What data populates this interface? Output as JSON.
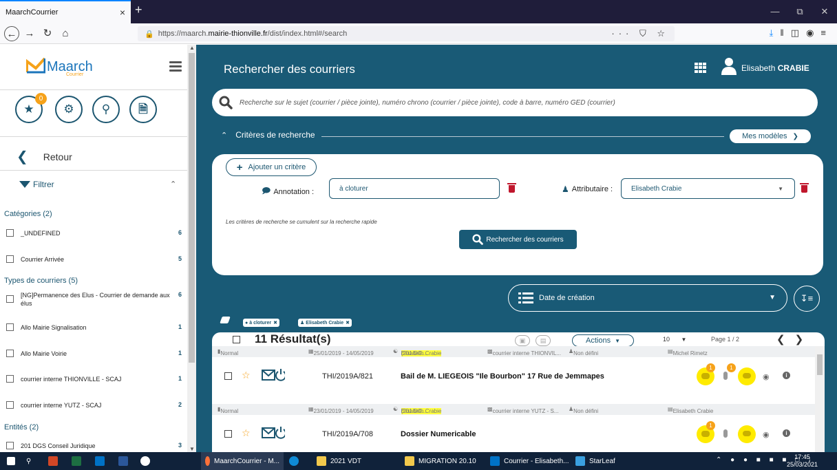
{
  "browser": {
    "tab_title": "MaarchCourrier",
    "tab_close": "×",
    "new_tab": "+",
    "url_prefix": "https://maarch.",
    "url_domain": "mairie-thionville.fr",
    "url_path": "/dist/index.html#/search",
    "url_icons": "··· ⛉ ☆"
  },
  "sidebar": {
    "logo_text": "Maarch",
    "logo_sub": "Courrier",
    "star_badge": "0",
    "retour_label": "Retour",
    "filter_label": "Filtrer",
    "categories_head": "Catégories (2)",
    "categories": [
      {
        "label": "_UNDEFINED",
        "count": "6"
      },
      {
        "label": "Courrier Arrivée",
        "count": "5"
      }
    ],
    "types_head": "Types de courriers (5)",
    "types": [
      {
        "label": "[NG]Permanence des Elus - Courrier de demande aux élus",
        "count": "6"
      },
      {
        "label": "Allo Mairie Signalisation",
        "count": "1"
      },
      {
        "label": "Allo Mairie Voirie",
        "count": "1"
      },
      {
        "label": "courrier interne THIONVILLE - SCAJ",
        "count": "1"
      },
      {
        "label": "courrier interne YUTZ - SCAJ",
        "count": "2"
      }
    ],
    "entites_head": "Entités (2)",
    "entites": [
      {
        "label": "201 DGS Conseil Juridique",
        "count": "3"
      }
    ]
  },
  "header": {
    "title": "Rechercher des courriers",
    "user_first": "Elisabeth",
    "user_last": "CRABIE"
  },
  "search": {
    "placeholder": "Recherche sur le sujet (courrier / pièce jointe), numéro chrono (courrier / pièce jointe), code à barre, numéro GED (courrier)"
  },
  "criteria": {
    "toggle_label": "Critères de recherche",
    "models_label": "Mes modèles",
    "add_label": "Ajouter un critère",
    "annotation_label": "Annotation :",
    "annotation_value": "à cloturer",
    "attributaire_label": "Attributaire :",
    "attributaire_value": "Elisabeth Crabie",
    "note": "Les critères de recherche se cumulent sur la recherche rapide",
    "search_button": "Rechercher des courriers"
  },
  "sort": {
    "label": "Date de création"
  },
  "chips": [
    "à cloturer",
    "Elisabeth Crabie"
  ],
  "results": {
    "count_label": "11 Résultat(s)",
    "actions_label": "Actions",
    "per_page": "10",
    "page_label": "Page 1 / 2",
    "rows": [
      {
        "priority": "Normal",
        "dates": "25/01/2019 - 14/05/2019",
        "dest_name": "Elisabeth Crabie",
        "dest_rest": "(201 DG...",
        "type": "courrier interne THIONVIL...",
        "contact": "Non défini",
        "author": "Michel Rimetz",
        "chrono": "THI/2019A/821",
        "subject": "Bail de M. LIEGEOIS \"Ile Bourbon\" 17 Rue de Jemmapes",
        "notes_count": "1",
        "attach_count": "1"
      },
      {
        "priority": "Normal",
        "dates": "23/01/2019 - 14/05/2019",
        "dest_name": "Elisabeth Crabie",
        "dest_rest": "(201 DG...",
        "type": "courrier interne YUTZ - S...",
        "contact": "Non défini",
        "author": "Elisabeth Crabie",
        "chrono": "THI/2019A/708",
        "subject": "Dossier Numericable",
        "notes_count": "1",
        "attach_count": ""
      }
    ]
  },
  "taskbar": {
    "items": [
      "MaarchCourrier - M...",
      "2021 VDT",
      "MIGRATION 20.10",
      "Courrier - Elisabeth...",
      "StarLeaf"
    ],
    "time": "17:45",
    "date": "25/03/2021"
  },
  "colors": {
    "main_bg": "#195a76",
    "accent_orange": "#f6a21a",
    "highlight": "#ffff3b",
    "delete_red": "#c0172d"
  }
}
